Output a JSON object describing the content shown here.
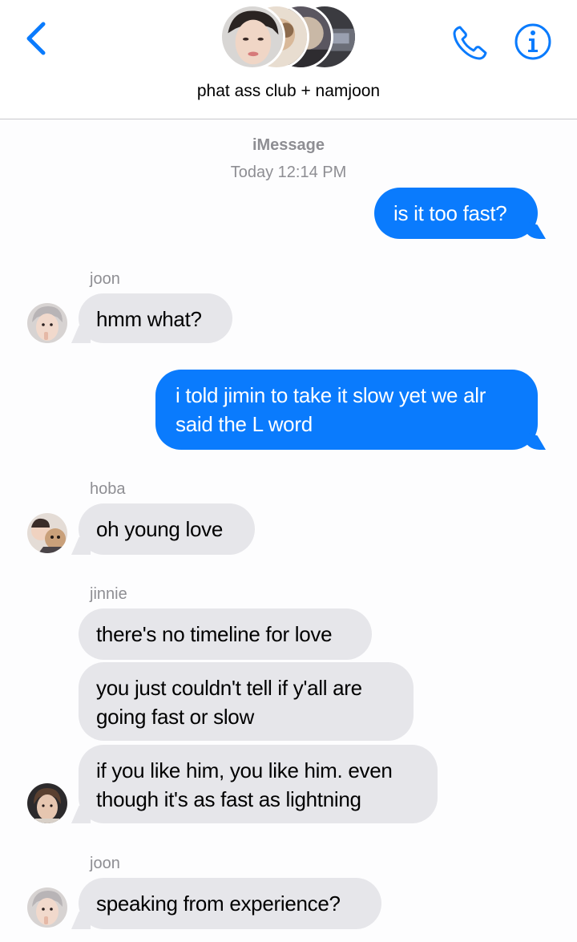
{
  "header": {
    "group_name": "phat ass club + namjoon",
    "icons": [
      "back-chevron-icon",
      "phone-icon",
      "info-icon"
    ],
    "accent_color": "#0a7bfd"
  },
  "thread": {
    "service": "iMessage",
    "timestamp": "Today 12:14 PM"
  },
  "messages": [
    {
      "direction": "outgoing",
      "text": "is it too fast?"
    },
    {
      "direction": "incoming",
      "sender": "joon",
      "text": "hmm what?"
    },
    {
      "direction": "outgoing",
      "text": "i told jimin to take it slow yet we alr said the L word"
    },
    {
      "direction": "incoming",
      "sender": "hoba",
      "text": "oh young love"
    },
    {
      "direction": "incoming",
      "sender": "jinnie",
      "text": "there's no timeline for love"
    },
    {
      "direction": "incoming",
      "text": "you just couldn't tell if y'all are going fast or slow"
    },
    {
      "direction": "incoming",
      "text": "if you like him, you like him. even though it's as fast as lightning"
    },
    {
      "direction": "incoming",
      "sender": "joon",
      "text": "speaking from experience?"
    }
  ],
  "colors": {
    "outgoing_bubble": "#0a7bfd",
    "incoming_bubble": "#e6e6ea",
    "meta_text": "#8e8e93"
  }
}
